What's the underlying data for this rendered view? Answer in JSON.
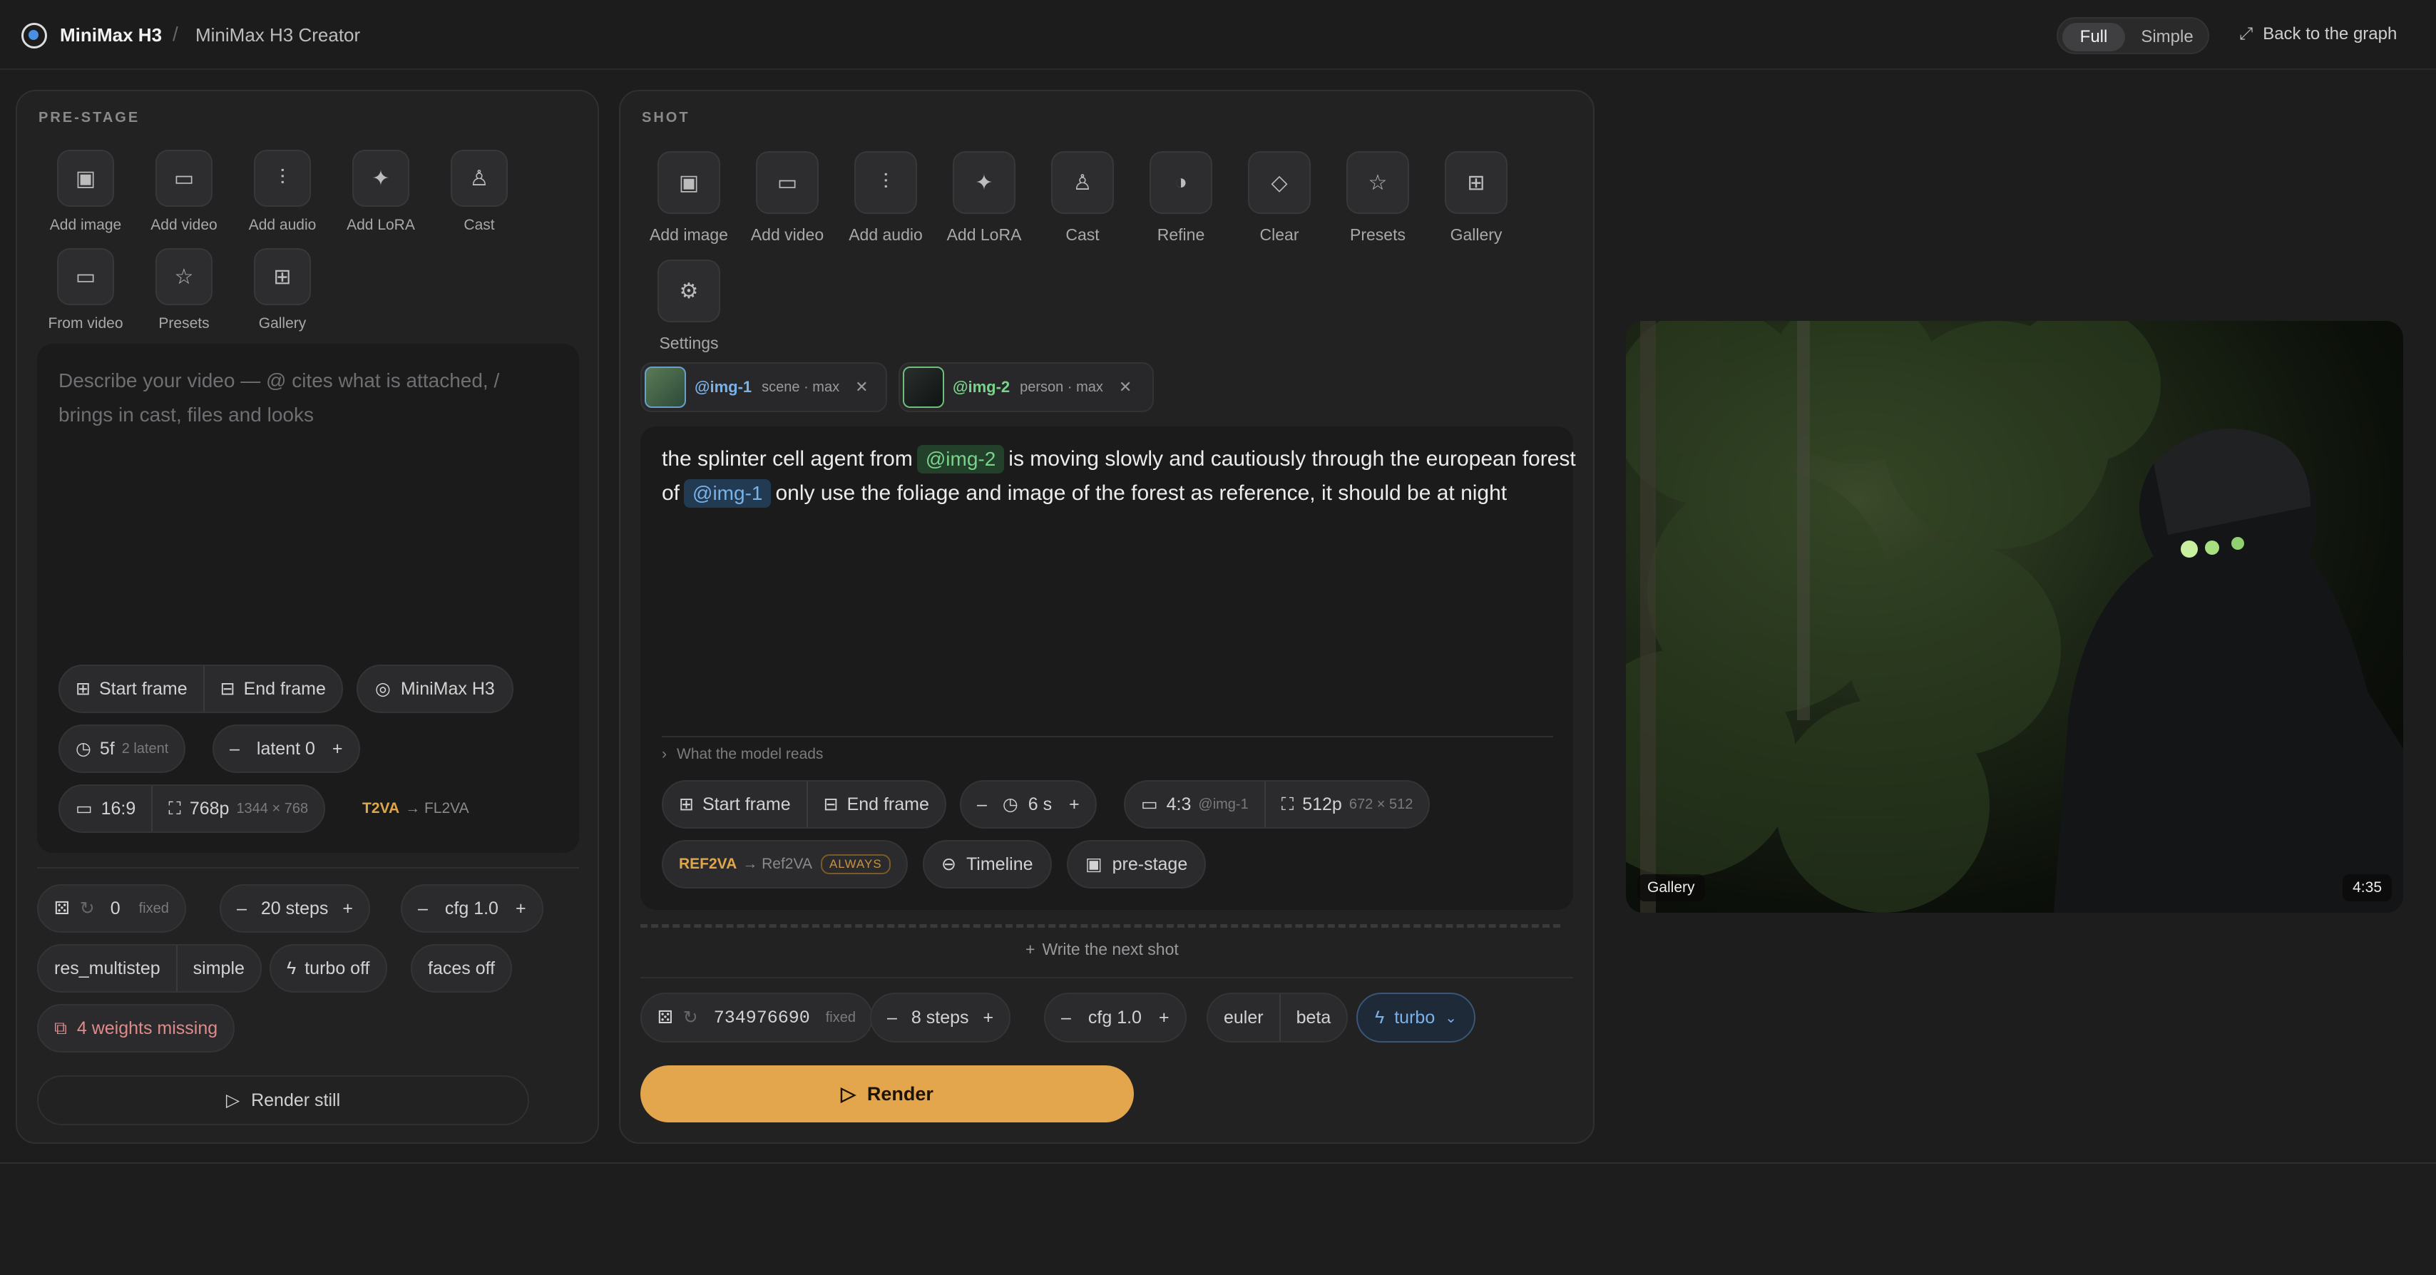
{
  "header": {
    "brand": "MiniMax H3",
    "separator": "/",
    "crumb": "MiniMax H3 Creator",
    "modes": [
      "Full",
      "Simple"
    ],
    "active_mode": "Full",
    "back": "Back to the graph"
  },
  "prestage": {
    "label": "PRE-STAGE",
    "tools": [
      "Add image",
      "Add video",
      "Add audio",
      "Add LoRA",
      "Cast",
      "From video",
      "Presets",
      "Gallery"
    ],
    "placeholder": "Describe your video — @ cites what is attached, / brings in cast, files and looks",
    "start_frame": "Start frame",
    "end_frame": "End frame",
    "model": "MiniMax H3",
    "frames": "5f",
    "frames_sub": "2 latent",
    "latent": "latent 0",
    "aspect": "16:9",
    "res": "768p",
    "res_sub": "1344 × 768",
    "mode_tag": "T2VA",
    "mode_arrow": "→ FL2VA",
    "seed": "0",
    "seed_mode": "fixed",
    "steps": "20 steps",
    "cfg": "cfg 1.0",
    "sampler": "res_multistep",
    "scheduler": "simple",
    "turbo": "turbo off",
    "faces": "faces off",
    "weights": "4 weights missing",
    "render": "Render still"
  },
  "shot": {
    "label": "SHOT",
    "tools": [
      "Add image",
      "Add video",
      "Add audio",
      "Add LoRA",
      "Cast",
      "Refine",
      "Clear",
      "Presets",
      "Gallery",
      "Settings"
    ],
    "refs": [
      {
        "tag": "@img-1",
        "meta": "scene · max"
      },
      {
        "tag": "@img-2",
        "meta": "person · max"
      }
    ],
    "prompt_a": "the splinter cell agent from",
    "prompt_tag1": "@img-2",
    "prompt_b": "is moving slowly and cautiously through the european forest of",
    "prompt_tag2": "@img-1",
    "prompt_c": "only use the foliage and image of the forest as reference, it should be at night",
    "model_reads": "What the model reads",
    "start_frame": "Start frame",
    "end_frame": "End frame",
    "duration": "6 s",
    "aspect": "4:3",
    "aspect_ref": "@img-1",
    "res": "512p",
    "res_sub": "672 × 512",
    "mode_tag": "REF2VA",
    "mode_arrow": "→ Ref2VA",
    "mode_badge": "ALWAYS",
    "timeline": "Timeline",
    "prestage": "pre-stage",
    "next_shot": "Write the next shot",
    "seed": "734976690",
    "seed_mode": "fixed",
    "steps": "8 steps",
    "cfg": "cfg 1.0",
    "sampler": "euler",
    "scheduler": "beta",
    "turbo": "turbo",
    "render": "Render"
  },
  "preview": {
    "badge": "Gallery",
    "time": "4:35"
  },
  "colors": {
    "accent": "#e4a64c",
    "bg": "#1d1d1e",
    "panel": "#222223",
    "tag_green": "#7ad38a",
    "tag_blue": "#7ab2e8"
  }
}
